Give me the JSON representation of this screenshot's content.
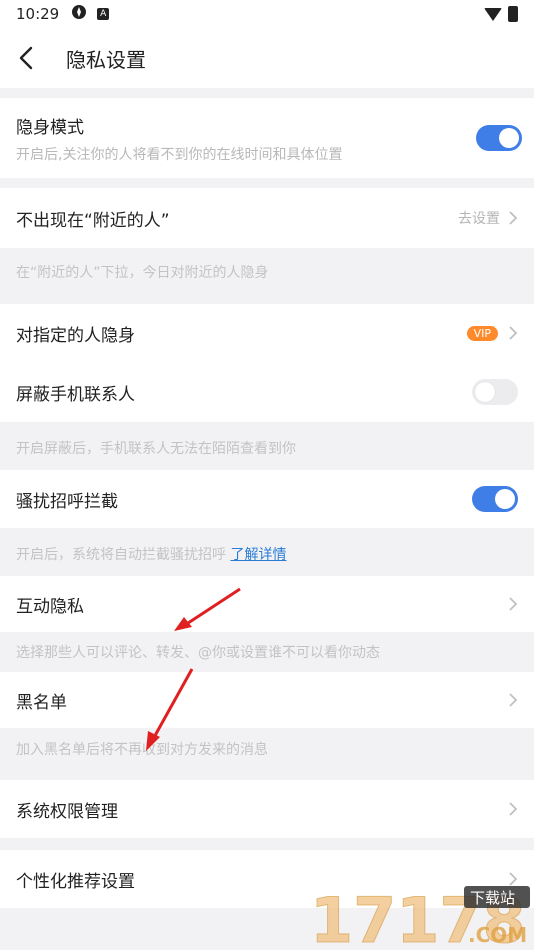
{
  "status_bar": {
    "time": "10:29",
    "a_icon_letter": "A"
  },
  "header": {
    "title": "隐私设置"
  },
  "settings": {
    "incognito": {
      "label": "隐身模式",
      "sub": "开启后,关注你的人将看不到你的在线时间和具体位置",
      "enabled": true
    },
    "nearby": {
      "label": "不出现在“附近的人”",
      "action": "去设置",
      "note": "在“附近的人”下拉，今日对附近的人隐身"
    },
    "hide_from_specific": {
      "label": "对指定的人隐身",
      "badge": "VIP"
    },
    "block_contacts": {
      "label": "屏蔽手机联系人",
      "enabled": false,
      "note": "开启屏蔽后，手机联系人无法在陌陌查看到你"
    },
    "harass_block": {
      "label": "骚扰招呼拦截",
      "enabled": true,
      "note": "开启后，系统将自动拦截骚扰招呼",
      "link": "了解详情"
    },
    "interaction_privacy": {
      "label": "互动隐私",
      "note": "选择那些人可以评论、转发、@你或设置谁不可以看你动态"
    },
    "blacklist": {
      "label": "黑名单",
      "note": "加入黑名单后将不再收到对方发来的消息"
    },
    "system_permissions": {
      "label": "系统权限管理"
    },
    "personalized": {
      "label": "个性化推荐设置"
    }
  },
  "watermark": {
    "number": "17178",
    "site": "下载站",
    "domain": ".COM"
  },
  "colors": {
    "accent": "#3f7ee6",
    "vip": "#ff8a2b",
    "annotation_arrow": "#e02020"
  }
}
